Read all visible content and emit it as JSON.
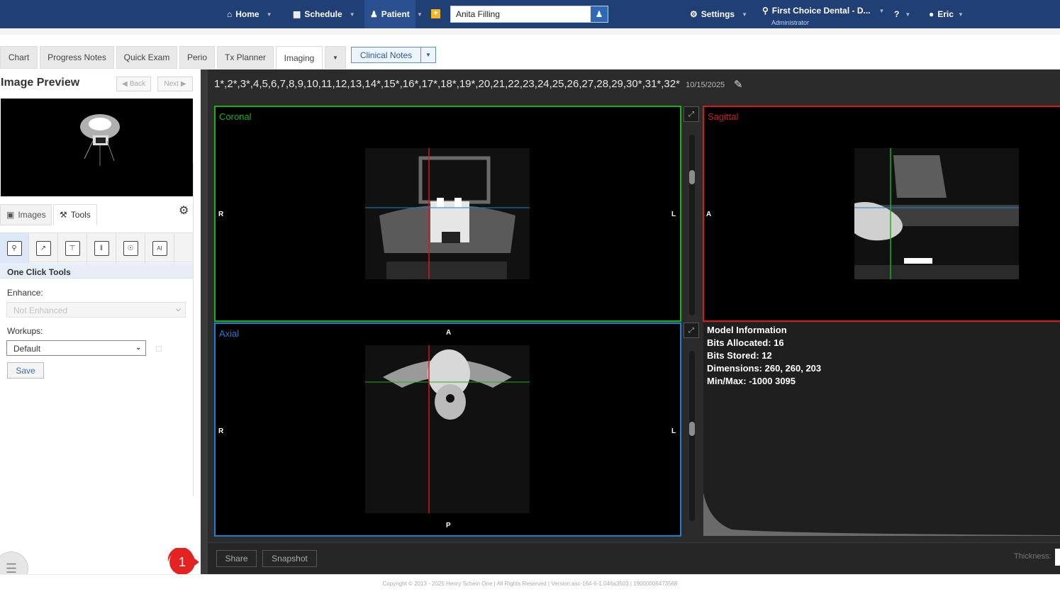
{
  "nav": {
    "home": "Home",
    "schedule": "Schedule",
    "patient": "Patient",
    "patient_search_value": "Anita Filling",
    "settings": "Settings",
    "location": "First Choice Dental - D...",
    "location_role": "Administrator",
    "user": "Eric",
    "icons": [
      "home-icon",
      "calendar-icon",
      "user-icon",
      "plus-icon",
      "patient-lookup-icon",
      "gear-icon",
      "map-pin-icon",
      "help-icon",
      "chat-user-icon"
    ]
  },
  "tabs": [
    {
      "label": "Chart"
    },
    {
      "label": "Progress Notes"
    },
    {
      "label": "Quick Exam"
    },
    {
      "label": "Perio"
    },
    {
      "label": "Tx Planner"
    },
    {
      "label": "Imaging"
    }
  ],
  "clinical_notes": "Clinical Notes",
  "left": {
    "title": "Image Preview",
    "back": "Back",
    "next": "Next",
    "tab_images": "Images",
    "tab_tools": "Tools",
    "section": "One Click Tools",
    "enhance_label": "Enhance:",
    "enhance_value": "Not Enhanced",
    "workups_label": "Workups:",
    "workups_value": "Default",
    "save": "Save"
  },
  "viewer": {
    "teeth": "1*,2*,3*,4,5,6,7,8,9,10,11,12,13,14*,15*,16*,17*,18*,19*,20,21,22,23,24,25,26,27,28,29,30*,31*,32*",
    "date": "10/15/2025",
    "coronal": "Coronal",
    "sagittal": "Sagittal",
    "axial": "Axial",
    "orient": {
      "R": "R",
      "L": "L",
      "A": "A",
      "P": "P"
    },
    "colors": {
      "coronal": "#17b217",
      "sagittal": "#d01c1c",
      "axial": "#1b7fd4"
    }
  },
  "model_info": {
    "title": "Model Information",
    "bits_allocated": "Bits Allocated: 16",
    "bits_stored": "Bits Stored: 12",
    "dimensions": "Dimensions: 260, 260, 203",
    "minmax": "Min/Max: -1000 3095"
  },
  "bottom": {
    "share": "Share",
    "snapshot": "Snapshot",
    "thickness": "Thickness:",
    "step_marker": "1"
  },
  "footer": "Copyright © 2013 - 2025 Henry Schein One | All Rights Reserved | Version:asc-164-6-1.046a3503 | 19000006473568"
}
